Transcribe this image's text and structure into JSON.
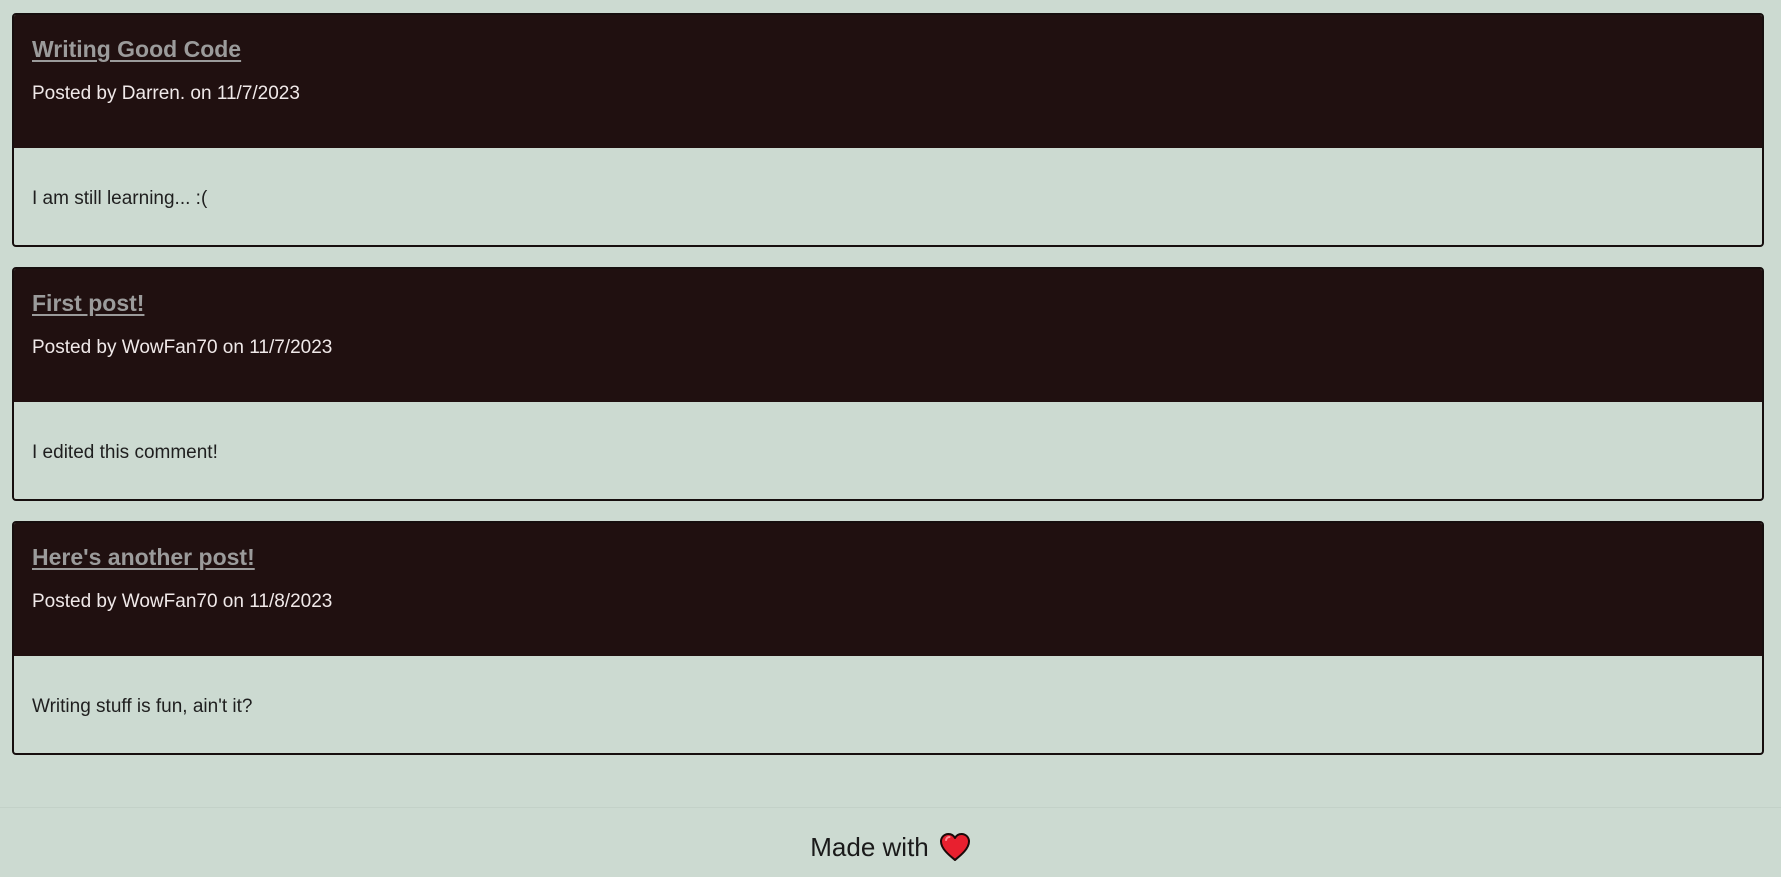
{
  "posts": [
    {
      "title": "Writing Good Code",
      "meta": "Posted by Darren. on 11/7/2023",
      "body": "I am still learning... :("
    },
    {
      "title": "First post!",
      "meta": "Posted by WowFan70 on 11/7/2023",
      "body": "I edited this comment!"
    },
    {
      "title": "Here's another post!",
      "meta": "Posted by WowFan70 on 11/8/2023",
      "body": "Writing stuff is fun, ain't it?"
    }
  ],
  "footer": {
    "text": "Made with",
    "icon": "heart-icon"
  },
  "colors": {
    "background": "#ccdad1",
    "header_bg": "#201010",
    "title_link": "#9b9b9b",
    "meta_text": "#f0e9e9",
    "heart": "#e8202f"
  }
}
